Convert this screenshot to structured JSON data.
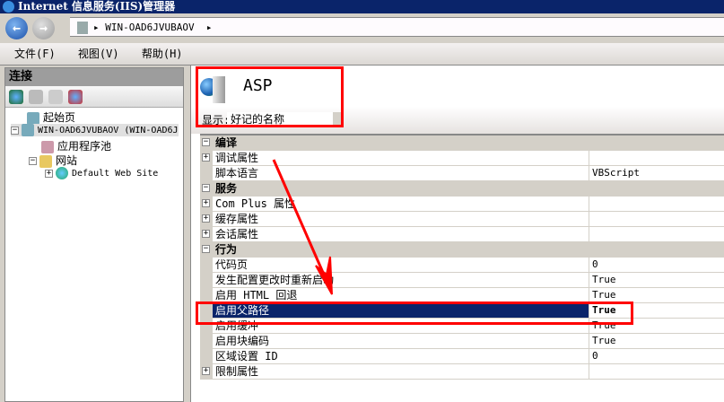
{
  "window": {
    "title": "Internet 信息服务(IIS)管理器"
  },
  "address": {
    "path": [
      "WIN-OAD6JVUBAOV"
    ]
  },
  "menu": [
    "文件(F)",
    "视图(V)",
    "帮助(H)"
  ],
  "connections": {
    "title": "连接",
    "tree": [
      {
        "label": "起始页"
      },
      {
        "label": "WIN-OAD6JVUBAOV (WIN-OAD6J"
      },
      {
        "label": "应用程序池"
      },
      {
        "label": "网站"
      },
      {
        "label": "Default Web Site"
      }
    ]
  },
  "feature": {
    "title": "ASP",
    "show_label": "显示:",
    "show_value": "好记的名称"
  },
  "grid": {
    "rows": [
      {
        "type": "cat",
        "name": "编译",
        "expander": "−"
      },
      {
        "type": "item",
        "name": "调试属性",
        "value": "",
        "expander": "+"
      },
      {
        "type": "item",
        "name": "脚本语言",
        "value": "VBScript"
      },
      {
        "type": "cat",
        "name": "服务",
        "expander": "−"
      },
      {
        "type": "item",
        "name": "Com Plus 属性",
        "value": "",
        "expander": "+"
      },
      {
        "type": "item",
        "name": "缓存属性",
        "value": "",
        "expander": "+"
      },
      {
        "type": "item",
        "name": "会话属性",
        "value": "",
        "expander": "+"
      },
      {
        "type": "cat",
        "name": "行为",
        "expander": "−"
      },
      {
        "type": "item",
        "name": "代码页",
        "value": "0"
      },
      {
        "type": "item",
        "name": "发生配置更改时重新启动",
        "value": "True"
      },
      {
        "type": "item",
        "name": "启用 HTML 回退",
        "value": "True"
      },
      {
        "type": "item",
        "name": "启用父路径",
        "value": "True",
        "selected": true
      },
      {
        "type": "item",
        "name": "启用缓冲",
        "value": "True"
      },
      {
        "type": "item",
        "name": "启用块编码",
        "value": "True"
      },
      {
        "type": "item",
        "name": "区域设置 ID",
        "value": "0"
      },
      {
        "type": "item",
        "name": "限制属性",
        "value": "",
        "expander": "+"
      }
    ]
  },
  "colors": {
    "annotation": "#ff0000",
    "selection": "#0a246a",
    "titlebar": "#0a246a"
  }
}
